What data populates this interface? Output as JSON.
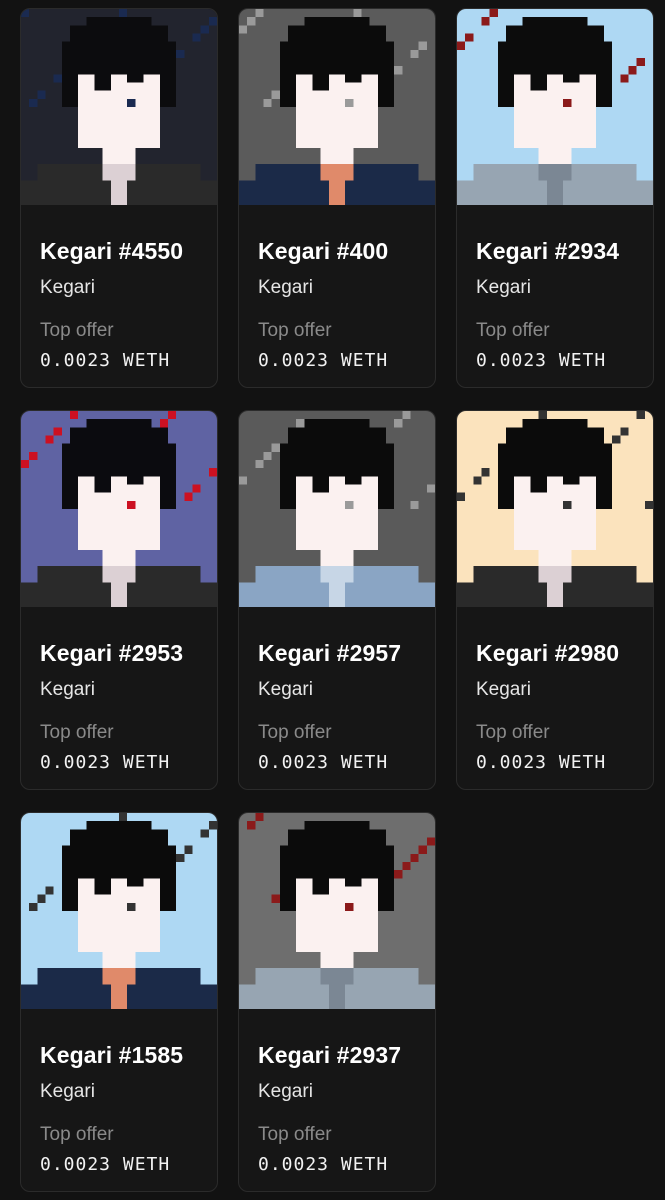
{
  "items": [
    {
      "name": "Kegari #4550",
      "collection": "Kegari",
      "offer_label": "Top offer",
      "offer_value": "0.0023 WETH",
      "bg": "#22242e",
      "hair": "#0c0c0e",
      "skin": "#fbf1f0",
      "shirt": "#2a2a2a",
      "collar": "#dcd0d4",
      "accent": "#1a2a50"
    },
    {
      "name": "Kegari #400",
      "collection": "Kegari",
      "offer_label": "Top offer",
      "offer_value": "0.0023 WETH",
      "bg": "#5b5b5b",
      "hair": "#0b0b0b",
      "skin": "#fbf1f0",
      "shirt": "#1b2a48",
      "collar": "#e08a6a",
      "accent": "#9a9a9a"
    },
    {
      "name": "Kegari #2934",
      "collection": "Kegari",
      "offer_label": "Top offer",
      "offer_value": "0.0023 WETH",
      "bg": "#aed8f3",
      "hair": "#0c0c0c",
      "skin": "#fbf1f0",
      "shirt": "#97a5b2",
      "collar": "#7b8794",
      "accent": "#8b1a1a"
    },
    {
      "name": "Kegari #2953",
      "collection": "Kegari",
      "offer_label": "Top offer",
      "offer_value": "0.0023 WETH",
      "bg": "#5f63a3",
      "hair": "#0b0b0f",
      "skin": "#fbf1f0",
      "shirt": "#2a2a2a",
      "collar": "#dcd0d4",
      "accent": "#cc1122"
    },
    {
      "name": "Kegari #2957",
      "collection": "Kegari",
      "offer_label": "Top offer",
      "offer_value": "0.0023 WETH",
      "bg": "#5a5a5a",
      "hair": "#0b0b0b",
      "skin": "#fbf1f0",
      "shirt": "#8aa5c4",
      "collar": "#c7d6e6",
      "accent": "#9a9a9a"
    },
    {
      "name": "Kegari #2980",
      "collection": "Kegari",
      "offer_label": "Top offer",
      "offer_value": "0.0023 WETH",
      "bg": "#fbe3bd",
      "hair": "#0b0b0b",
      "skin": "#fbf1f0",
      "shirt": "#2a2a2a",
      "collar": "#dcd0d4",
      "accent": "#333333"
    },
    {
      "name": "Kegari #1585",
      "collection": "Kegari",
      "offer_label": "Top offer",
      "offer_value": "0.0023 WETH",
      "bg": "#aed8f3",
      "hair": "#0b0b0b",
      "skin": "#fbf1f0",
      "shirt": "#1b2a48",
      "collar": "#e08a6a",
      "accent": "#333333"
    },
    {
      "name": "Kegari #2937",
      "collection": "Kegari",
      "offer_label": "Top offer",
      "offer_value": "0.0023 WETH",
      "bg": "#6e6e6e",
      "hair": "#0b0b0b",
      "skin": "#fbf1f0",
      "shirt": "#97a5b2",
      "collar": "#7b8794",
      "accent": "#8b1a1a"
    }
  ]
}
